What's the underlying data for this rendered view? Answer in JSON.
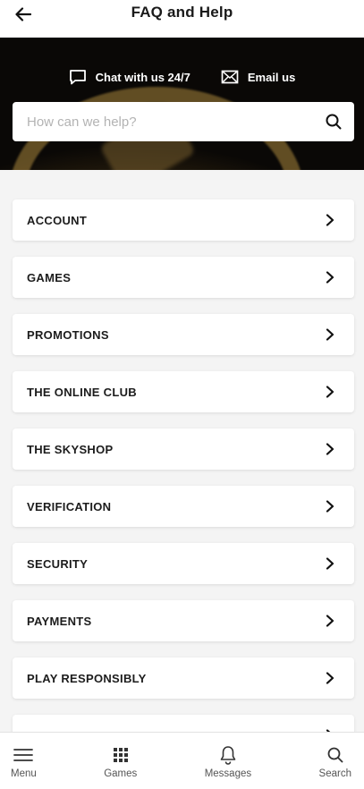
{
  "header": {
    "title": "FAQ and Help",
    "back_icon": "arrow-left-icon"
  },
  "hero": {
    "chat_label": "Chat with us 24/7",
    "email_label": "Email us",
    "search_placeholder": "How can we help?",
    "search_value": ""
  },
  "categories": [
    {
      "label": "ACCOUNT"
    },
    {
      "label": "GAMES"
    },
    {
      "label": "PROMOTIONS"
    },
    {
      "label": "THE ONLINE CLUB"
    },
    {
      "label": "THE SKYSHOP"
    },
    {
      "label": "VERIFICATION"
    },
    {
      "label": "SECURITY"
    },
    {
      "label": "PAYMENTS"
    },
    {
      "label": "PLAY RESPONSIBLY"
    },
    {
      "label": ""
    }
  ],
  "bottom_nav": [
    {
      "label": "Menu",
      "icon": "menu-icon"
    },
    {
      "label": "Games",
      "icon": "grid-icon"
    },
    {
      "label": "Messages",
      "icon": "bell-icon"
    },
    {
      "label": "Search",
      "icon": "search-icon"
    }
  ],
  "colors": {
    "text": "#1a1a1a",
    "hero_bg": "#0b0907",
    "card": "#ffffff",
    "page_bg": "#f4f4f4"
  }
}
